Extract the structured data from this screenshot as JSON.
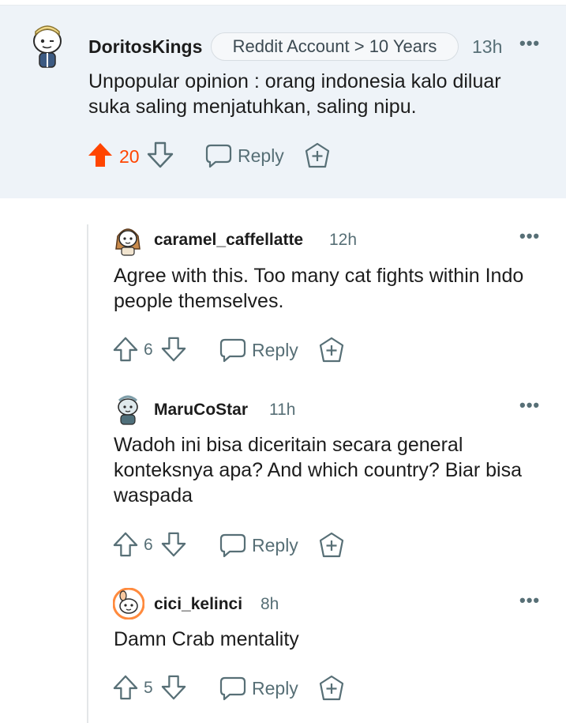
{
  "comments": [
    {
      "username": "DoritosKings",
      "flair": "Reddit Account > 10 Years",
      "time": "13h",
      "body": "Unpopular opinion : orang indonesia kalo diluar suka saling menjatuhkan, saling nipu.",
      "score": "20",
      "vote_state": "upvoted",
      "reply_label": "Reply"
    },
    {
      "username": "caramel_caffellatte",
      "time": "12h",
      "body": "Agree with this. Too many cat fights within Indo people themselves.",
      "score": "6",
      "reply_label": "Reply"
    },
    {
      "username": "MaruCoStar",
      "time": "11h",
      "body": "Wadoh ini bisa diceritain secara general konteksnya apa? And which country? Biar bisa waspada",
      "score": "6",
      "reply_label": "Reply"
    },
    {
      "username": "cici_kelinci",
      "time": "8h",
      "body": "Damn Crab mentality",
      "score": "5",
      "reply_label": "Reply"
    }
  ],
  "colors": {
    "upvote_active": "#ff4500",
    "highlight_bg": "#eef3f8",
    "muted": "#576f76"
  },
  "icons": [
    "upvote-icon",
    "downvote-icon",
    "reply-bubble-icon",
    "award-plus-icon",
    "more-options-icon",
    "avatar-icon"
  ]
}
